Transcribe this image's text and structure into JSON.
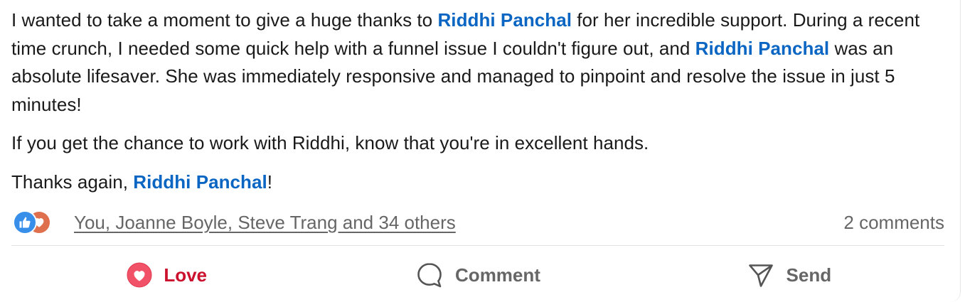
{
  "post": {
    "paragraphs": [
      {
        "segments": [
          {
            "text": "I wanted to take a moment to give a huge thanks to ",
            "mention": false
          },
          {
            "text": "Riddhi Panchal",
            "mention": true
          },
          {
            "text": " for her incredible support. During a recent time crunch, I needed some quick help with a funnel issue I couldn't figure out, and ",
            "mention": false
          },
          {
            "text": "Riddhi Panchal",
            "mention": true
          },
          {
            "text": " was an absolute lifesaver. She was immediately responsive and managed to pinpoint and resolve the issue in just 5 minutes!",
            "mention": false
          }
        ]
      },
      {
        "segments": [
          {
            "text": "If you get the chance to work with Riddhi, know that you're in excellent hands.",
            "mention": false
          }
        ]
      },
      {
        "segments": [
          {
            "text": "Thanks again, ",
            "mention": false
          },
          {
            "text": "Riddhi Panchal",
            "mention": true
          },
          {
            "text": "!",
            "mention": false
          }
        ]
      }
    ]
  },
  "social": {
    "reaction_icons": [
      "like-icon",
      "love-icon"
    ],
    "reactors_text": "You, Joanne Boyle, Steve Trang and 34 others",
    "comments_text": "2 comments"
  },
  "actions": {
    "love": {
      "label": "Love",
      "icon": "love-icon",
      "active": true
    },
    "comment": {
      "label": "Comment",
      "icon": "comment-icon",
      "active": false
    },
    "send": {
      "label": "Send",
      "icon": "send-icon",
      "active": false
    }
  },
  "colors": {
    "mention": "#0a66c2",
    "love_active": "#cb112d",
    "muted_text": "#666666",
    "like_blue": "#378fe9",
    "love_red": "#df704d"
  }
}
